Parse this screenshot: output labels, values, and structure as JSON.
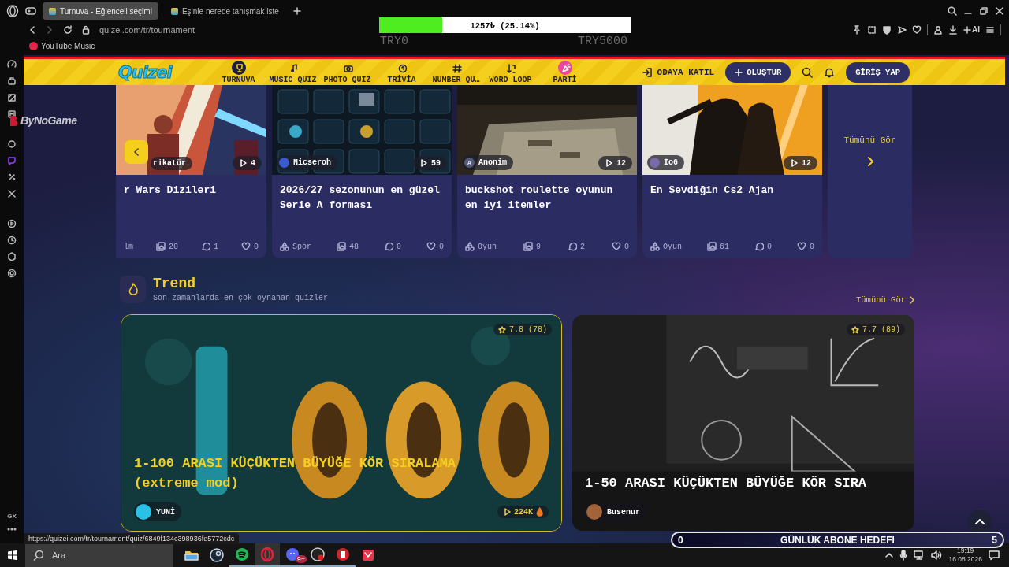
{
  "browser": {
    "tabs": [
      {
        "title": "Turnuva - Eğlenceli seçiml",
        "selected": true
      },
      {
        "title": "Eşinle nerede tanışmak iste",
        "selected": false
      }
    ],
    "address": "quizei.com/tr/tournament",
    "ai_label": "AI",
    "bookmarks": [
      "YouTube Music"
    ]
  },
  "stream_overlay": {
    "donation_bar": {
      "label": "1257₺ (25.14%)",
      "level": 0.2514
    },
    "min_label": "TRY0",
    "max_label": "TRY5000",
    "logo": "ByNoGame",
    "goal": {
      "start": "0",
      "title": "GÜNLÜK ABONE HEDEFI",
      "end": "5"
    }
  },
  "site_header": {
    "logo": "Quizei",
    "nav": [
      {
        "label": "TURNUVA",
        "selected": true
      },
      {
        "label": "MUSIC QUIZ",
        "selected": false
      },
      {
        "label": "PHOTO QUIZ",
        "selected": false
      },
      {
        "label": "TRİVİA",
        "selected": false
      },
      {
        "label": "NUMBER QU…",
        "selected": false
      },
      {
        "label": "WORD LOOP",
        "selected": false
      },
      {
        "label": "PARTİ",
        "selected": false
      }
    ],
    "join": "ODAYA KATIL",
    "create": "OLUŞTUR",
    "login": "GİRİŞ YAP"
  },
  "carousel": {
    "cards": [
      {
        "kind": "quiz",
        "author": "rikatür",
        "plays": "4",
        "title": "r Wars Dizileri",
        "category": "lm",
        "images": "20",
        "comments": "1",
        "likes": "0"
      },
      {
        "kind": "quiz",
        "author": "Nicseroh",
        "plays": "59",
        "title": "2026/27 sezonunun en güzel Serie A forması",
        "category": "Spor",
        "images": "48",
        "comments": "0",
        "likes": "0"
      },
      {
        "kind": "quiz",
        "author": "Anonim",
        "avatar_letter": "A",
        "plays": "12",
        "title": "buckshot roulette oyunun en iyi itemler",
        "category": "Oyun",
        "images": "9",
        "comments": "2",
        "likes": "0"
      },
      {
        "kind": "quiz",
        "author": "İo6",
        "plays": "12",
        "title": "En Sevdiğin Cs2 Ajan",
        "category": "Oyun",
        "images": "61",
        "comments": "0",
        "likes": "0"
      },
      {
        "kind": "see_all",
        "label": "Tümünü Gör"
      }
    ]
  },
  "trend": {
    "title": "Trend",
    "subtitle": "Son zamanlarda en çok oynanan quizler",
    "see_all": "Tümünü Gör",
    "cards": [
      {
        "rating": "7.8 (78)",
        "title": "1-100 ARASI KÜÇÜKTEN BÜYÜĞE KÖR SIRALAMA (extreme mod)",
        "author": "YUNİ",
        "plays": "224K",
        "highlighted": true
      },
      {
        "rating": "7.7 (89)",
        "title": "1-50 ARASI KÜÇÜKTEN BÜYÜĞE KÖR SIRA",
        "author": "Busenur",
        "highlighted": false
      }
    ]
  },
  "status_url": "https://quizei.com/tr/tournament/quiz/6849f134c398936fe5772cdc",
  "opera_sidebar": {
    "bottom_label": "GX"
  },
  "taskbar": {
    "placeholder": "Ara",
    "apps": [
      {
        "running": false,
        "selected": false
      },
      {
        "running": false,
        "selected": false
      },
      {
        "running": true,
        "selected": false
      },
      {
        "running": true,
        "selected": true
      },
      {
        "running": true,
        "selected": false
      },
      {
        "running": true,
        "selected": false
      },
      {
        "running": true,
        "selected": false
      },
      {
        "running": false,
        "selected": false
      }
    ],
    "badge": "9+",
    "time": "19:19",
    "date": "16.08.2026"
  }
}
